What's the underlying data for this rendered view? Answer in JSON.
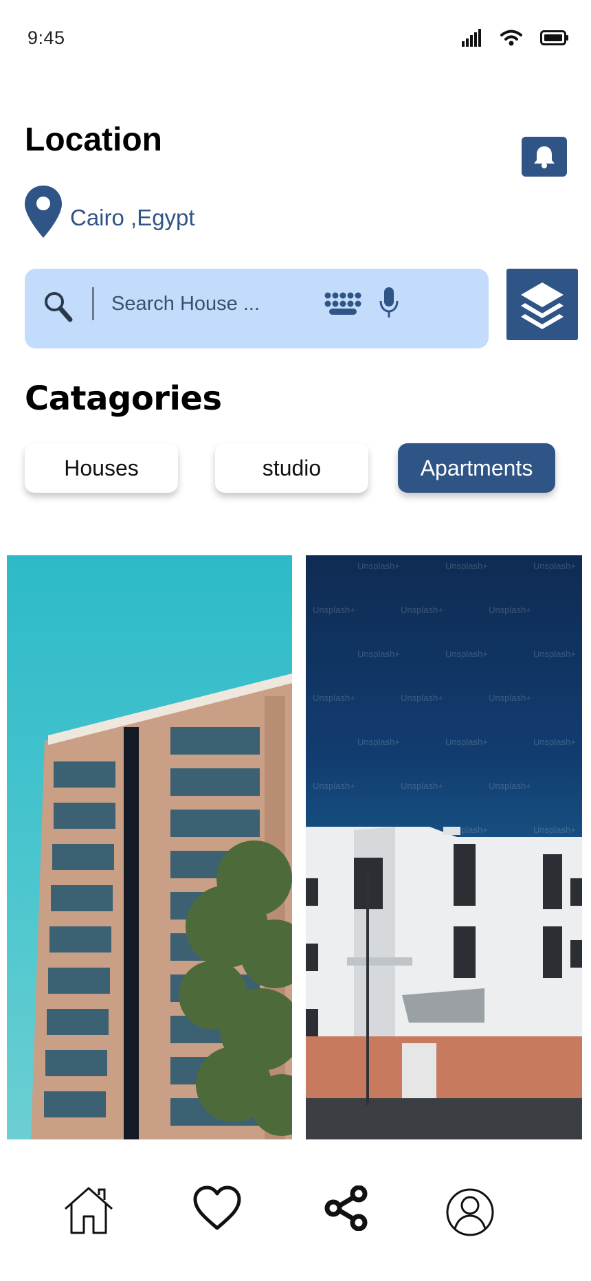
{
  "status_bar": {
    "time": "9:45",
    "icons": [
      "signal-icon",
      "wifi-icon",
      "battery-icon"
    ]
  },
  "header": {
    "title": "Location",
    "location": "Cairo ,Egypt",
    "notification_icon": "bell-icon"
  },
  "search": {
    "placeholder": "Search House ...",
    "value": "",
    "icons": [
      "search-icon",
      "keyboard-icon",
      "microphone-icon"
    ],
    "filter_icon": "layers-icon"
  },
  "categories": {
    "title": "Catagories",
    "items": [
      {
        "label": "Houses",
        "selected": false
      },
      {
        "label": "studio",
        "selected": false
      },
      {
        "label": "Apartments",
        "selected": true
      }
    ]
  },
  "listings": [
    {
      "kind": "photo",
      "subject": "tall brick apartment tower"
    },
    {
      "kind": "photo",
      "subject": "white modern apartment building",
      "watermark": "Unsplash+"
    }
  ],
  "bottom_nav": {
    "items": [
      "home-icon",
      "heart-icon",
      "share-icon",
      "profile-icon"
    ]
  },
  "colors": {
    "primary": "#2f5486",
    "search_bg": "#c3dcfb",
    "chip_bg": "#ffffff"
  }
}
